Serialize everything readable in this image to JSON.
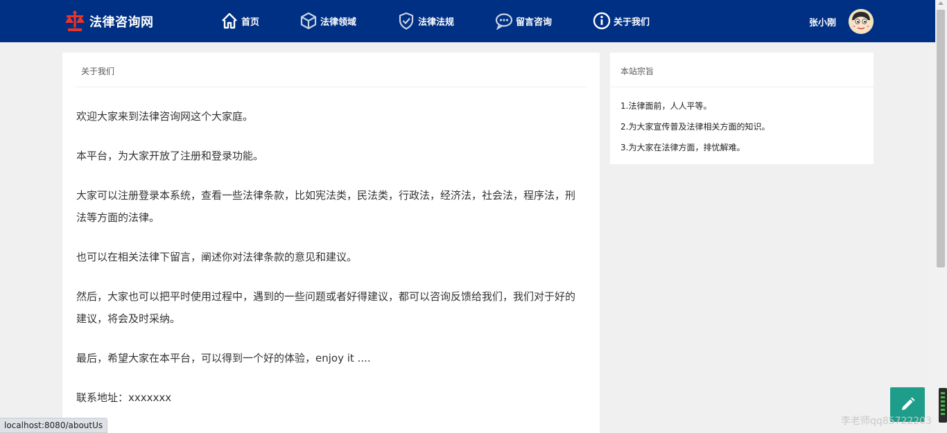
{
  "brand": {
    "name": "法律咨询网",
    "logo_color": "#e8352b"
  },
  "nav": [
    {
      "label": "首页",
      "icon": "home-icon"
    },
    {
      "label": "法律领域",
      "icon": "cube-icon"
    },
    {
      "label": "法律法规",
      "icon": "shield-check-icon"
    },
    {
      "label": "留言咨询",
      "icon": "chat-bubble-icon"
    },
    {
      "label": "关于我们",
      "icon": "info-icon"
    }
  ],
  "user": {
    "name": "张小刚"
  },
  "main": {
    "title": "关于我们",
    "paragraphs": [
      "欢迎大家来到法律咨询网这个大家庭。",
      "本平台，为大家开放了注册和登录功能。",
      "大家可以注册登录本系统，查看一些法律条款，比如宪法类，民法类，行政法，经济法，社会法，程序法，刑法等方面的法律。",
      "也可以在相关法律下留言，阐述你对法律条款的意见和建议。",
      "然后，大家也可以把平时使用过程中，遇到的一些问题或者好得建议，都可以咨询反馈给我们，我们对于好的建议，将会及时采纳。",
      "最后，希望大家在本平台，可以得到一个好的体验，enjoy it ....",
      "联系地址：xxxxxxx"
    ]
  },
  "side": {
    "title": "本站宗旨",
    "items": [
      "1.法律面前，人人平等。",
      "2.为大家宣传普及法律相关方面的知识。",
      "3.为大家在法律方面，排忧解难。"
    ]
  },
  "status_url": "localhost:8080/aboutUs",
  "watermark": "李老师qq85722203",
  "colors": {
    "header_bg": "#003083",
    "edit_button": "#1e9e8a"
  }
}
